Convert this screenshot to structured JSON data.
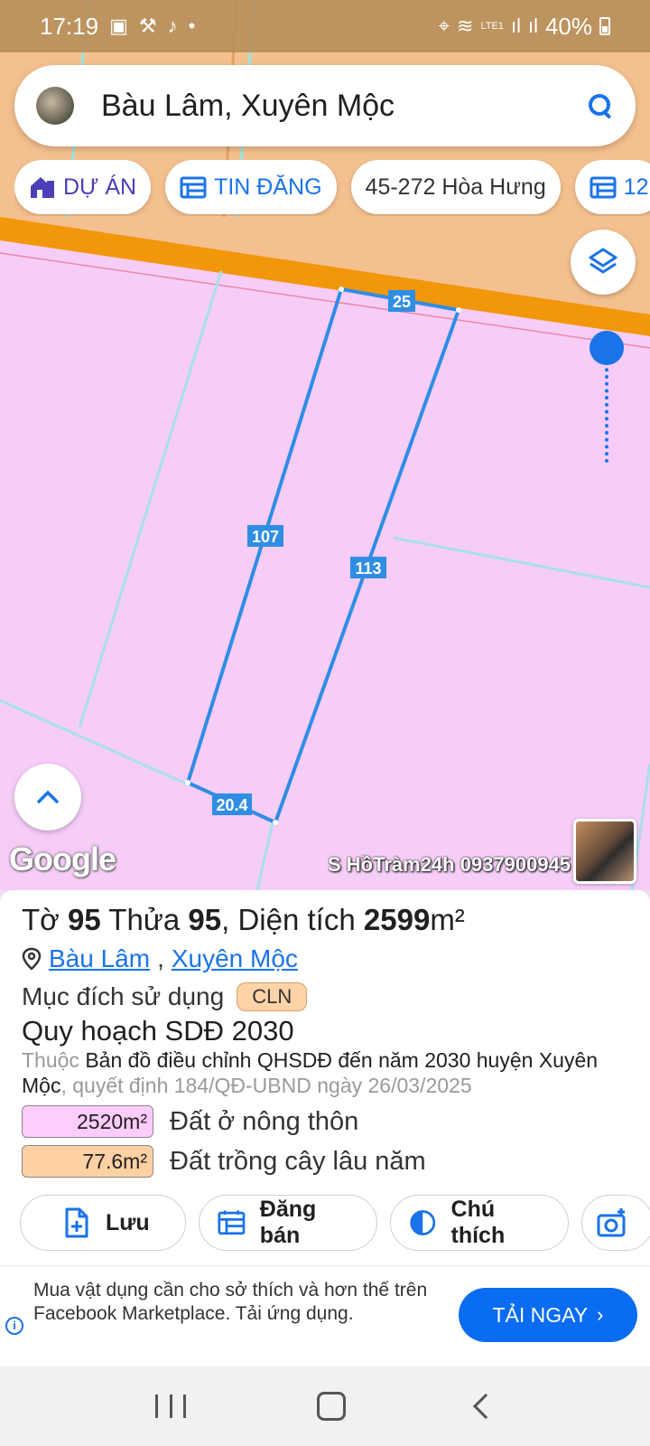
{
  "status_bar": {
    "time": "17:19",
    "battery": "40%",
    "network": "LTE1"
  },
  "search": {
    "text": "Bàu Lâm, Xuyên Mộc"
  },
  "chips": [
    {
      "label": "DỰ ÁN",
      "icon": "house-icon"
    },
    {
      "label": "TIN ĐĂNG",
      "icon": "calendar-icon"
    },
    {
      "label": "45-272 Hòa Hưng"
    },
    {
      "label": "12",
      "icon": "calendar-icon"
    }
  ],
  "map": {
    "edge_labels": [
      "25",
      "107",
      "113",
      "20.4"
    ],
    "google_logo": "Google",
    "watermark": "S HồTràm24h 0937900945"
  },
  "parcel": {
    "to_label": "Tờ",
    "to_value": "95",
    "thua_label": "Thửa",
    "thua_value": "95",
    "area_label": ", Diện tích",
    "area_value": "2599",
    "area_unit": "m²",
    "ward": "Bàu Lâm",
    "district": "Xuyên Mộc",
    "purpose_label": "Mục đích sử dụng",
    "purpose_code": "CLN",
    "plan_title": "Quy hoạch SDĐ 2030",
    "plan_prefix": "Thuộc",
    "plan_map": "Bản đồ điều chỉnh QHSDĐ đến năm 2030 huyện Xuyên Mộc",
    "plan_decision": ", quyết định 184/QĐ-UBND ngày 26/03/2025",
    "areas": [
      {
        "value": "2520m²",
        "label": "Đất ở nông thôn",
        "color": "#ffccff"
      },
      {
        "value": "77.6m²",
        "label": "Đất trồng cây lâu năm",
        "color": "#ffd1a3"
      }
    ]
  },
  "actions": [
    {
      "label": "Lưu",
      "icon": "save-file-icon"
    },
    {
      "label": "Đăng bán",
      "icon": "calendar-icon"
    },
    {
      "label": "Chú thích",
      "icon": "legend-icon"
    },
    {
      "label": "",
      "icon": "add-photo-icon"
    }
  ],
  "ad": {
    "text": "Mua vật dụng cần cho sở thích và hơn thế trên Facebook Marketplace. Tải ứng dụng.",
    "cta": "TẢI NGAY"
  },
  "colors": {
    "residential": "#f3d0f7",
    "perennial": "#f5c08f",
    "road": "#f2960a",
    "parcel_line": "#2f8de4",
    "accent": "#1a73e8"
  }
}
